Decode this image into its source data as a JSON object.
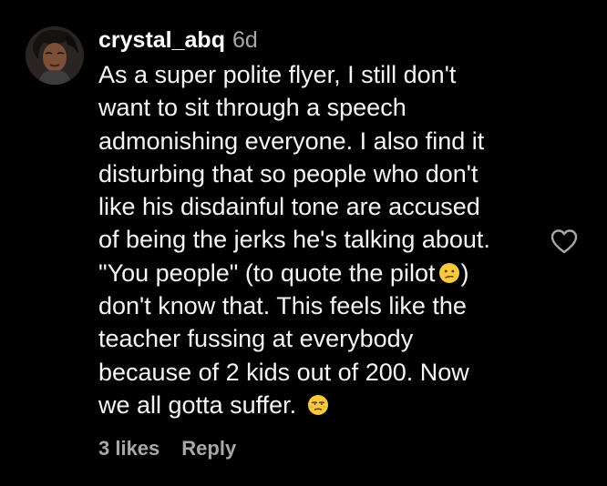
{
  "comment": {
    "username": "crystal_abq",
    "time_ago": "6d",
    "lines": [
      "As a super polite flyer, I still don't",
      "want to sit through a speech",
      "admonishing everyone. I also find it",
      "disturbing that so people who don't",
      "like his disdainful tone are accused",
      "of being the jerks he's talking about.",
      "\"You people\" (to quote the pilot",
      "don't know that. This feels like the",
      "teacher fussing at everybody",
      "because of 2 kids out of 200. Now",
      "we all gotta suffer."
    ],
    "inline_texts": {
      "after_pilot_emoji": ")"
    },
    "emojis": {
      "line7": "confused-face-emoji",
      "line11": "unamused-face-emoji"
    },
    "likes_label": "3 likes",
    "reply_label": "Reply",
    "like_icon": "heart-outline-icon"
  },
  "colors": {
    "background": "#000000",
    "text": "#f5f5f5",
    "secondary_text": "#a8a8a8",
    "emoji": "#f7c93b"
  }
}
